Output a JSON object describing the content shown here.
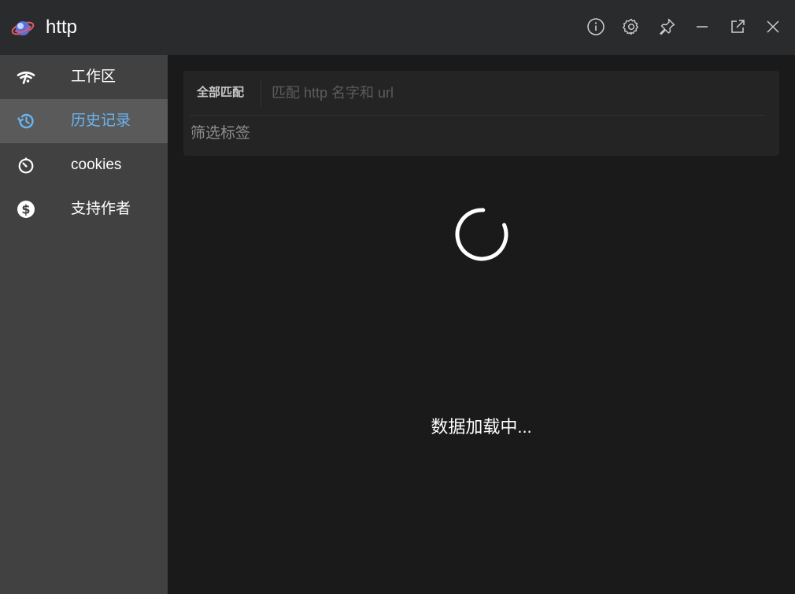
{
  "app": {
    "title": "http",
    "logo_icon": "planet-logo"
  },
  "titlebar": {
    "buttons": [
      {
        "name": "info-icon"
      },
      {
        "name": "gear-icon"
      },
      {
        "name": "pin-icon"
      },
      {
        "name": "minimize-icon"
      },
      {
        "name": "popout-icon"
      },
      {
        "name": "close-icon"
      }
    ]
  },
  "sidebar": {
    "items": [
      {
        "label": "工作区",
        "icon": "workspace-icon",
        "active": false
      },
      {
        "label": "历史记录",
        "icon": "history-icon",
        "active": true
      },
      {
        "label": "cookies",
        "icon": "timer-icon",
        "active": false
      },
      {
        "label": "支持作者",
        "icon": "dollar-icon",
        "active": false
      }
    ],
    "active_color": "#6ab4f0"
  },
  "filter": {
    "match_mode": "全部匹配",
    "search_value": "",
    "search_placeholder": "匹配 http 名字和 url",
    "tag_placeholder": "筛选标签"
  },
  "status": {
    "loading_text": "数据加载中..."
  }
}
